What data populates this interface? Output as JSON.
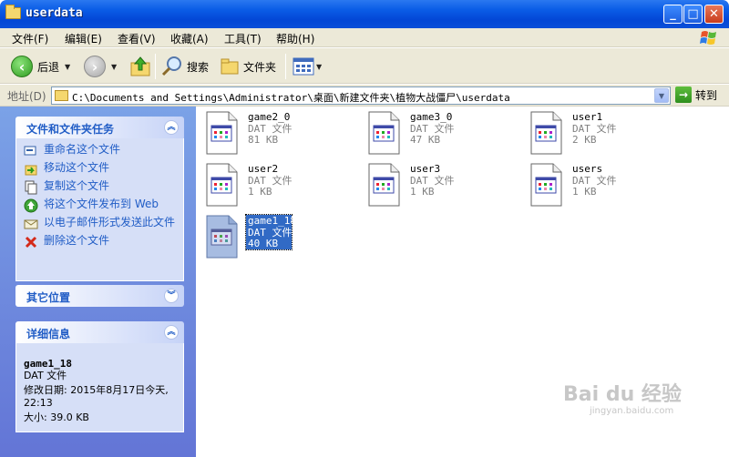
{
  "window": {
    "title": "userdata",
    "min_label": "_",
    "max_label": "□",
    "close_label": "✕"
  },
  "menu": [
    "文件(F)",
    "编辑(E)",
    "查看(V)",
    "收藏(A)",
    "工具(T)",
    "帮助(H)"
  ],
  "toolbar": {
    "back_label": "后退",
    "search_label": "搜索",
    "folders_label": "文件夹"
  },
  "address": {
    "label": "地址(D)",
    "path": "C:\\Documents and Settings\\Administrator\\桌面\\新建文件夹\\植物大战僵尸\\userdata",
    "go_label": "转到"
  },
  "tasks_panel": {
    "title": "文件和文件夹任务",
    "items": [
      "重命名这个文件",
      "移动这个文件",
      "复制这个文件",
      "将这个文件发布到 Web",
      "以电子邮件形式发送此文件",
      "删除这个文件"
    ]
  },
  "other_panel": {
    "title": "其它位置"
  },
  "details_panel": {
    "title": "详细信息",
    "name": "game1_18",
    "type": "DAT 文件",
    "modified": "修改日期: 2015年8月17日今天, 22:13",
    "size": "大小: 39.0 KB"
  },
  "files": [
    {
      "name": "game2_0",
      "type": "DAT 文件",
      "size": "81 KB",
      "selected": false
    },
    {
      "name": "game3_0",
      "type": "DAT 文件",
      "size": "47 KB",
      "selected": false
    },
    {
      "name": "user1",
      "type": "DAT 文件",
      "size": "2 KB",
      "selected": false
    },
    {
      "name": "user2",
      "type": "DAT 文件",
      "size": "1 KB",
      "selected": false
    },
    {
      "name": "user3",
      "type": "DAT 文件",
      "size": "1 KB",
      "selected": false
    },
    {
      "name": "users",
      "type": "DAT 文件",
      "size": "1 KB",
      "selected": false
    },
    {
      "name": "game1_18",
      "type": "DAT 文件",
      "size": "40 KB",
      "selected": true
    }
  ],
  "watermark": {
    "line1": "Bai du 经验",
    "line2": "jingyan.baidu.com"
  },
  "colors": {
    "title_blue": "#0a5ce6",
    "task_link": "#215dc6",
    "selection": "#316ac5"
  }
}
